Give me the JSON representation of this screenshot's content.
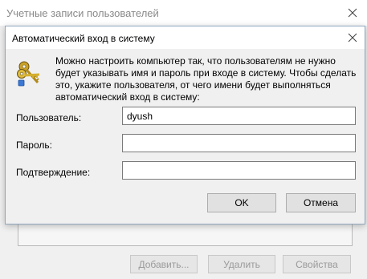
{
  "background_window": {
    "title": "Учетные записи пользователей",
    "buttons": {
      "add": "Добавить...",
      "remove": "Удалить",
      "properties": "Свойства"
    }
  },
  "dialog": {
    "title": "Автоматический вход в систему",
    "description": "Можно настроить компьютер так, что пользователям не нужно будет указывать имя и пароль при входе в систему. Чтобы сделать это, укажите пользователя, от чего имени будет выполняться автоматический вход в систему:",
    "fields": {
      "user_label": "Пользователь:",
      "user_value": "dyush",
      "password_label": "Пароль:",
      "password_value": "",
      "confirm_label": "Подтверждение:",
      "confirm_value": ""
    },
    "ok_label": "OK",
    "cancel_label": "Отмена"
  },
  "icons": {
    "dialog_icon": "keys-icon",
    "close": "close-icon"
  }
}
